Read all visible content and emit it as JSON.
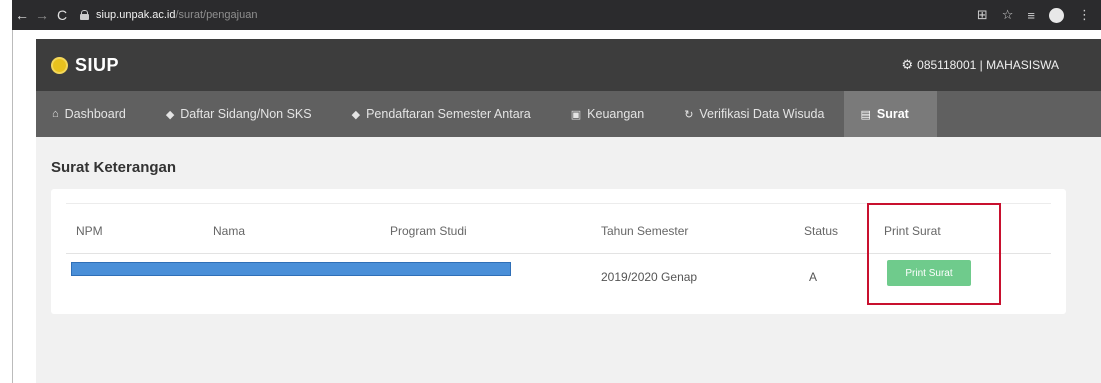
{
  "browser": {
    "url_host": "siup.unpak.ac.id",
    "url_path": "/surat/pengajuan",
    "icons": [
      "back-arrow-icon",
      "forward-arrow-icon",
      "reload-icon",
      "lock-icon",
      "translate-icon",
      "star-icon",
      "reading-list-icon",
      "profile-icon",
      "menu-icon"
    ]
  },
  "app": {
    "brand": "SIUP",
    "user": "085118001 | MAHASISWA",
    "colors": {
      "header": "#3d3d3d",
      "nav": "#606060",
      "nav_active": "#7a7a7a",
      "logo": "#e8c21e",
      "button": "#6fcb8c",
      "highlight": "#c8102e"
    }
  },
  "nav": {
    "items": [
      {
        "label": "Dashboard",
        "icon": "home-icon"
      },
      {
        "label": "Daftar Sidang/Non SKS",
        "icon": "graduation-cap-icon"
      },
      {
        "label": "Pendaftaran Semester Antara",
        "icon": "graduation-cap-icon"
      },
      {
        "label": "Keuangan",
        "icon": "money-icon"
      },
      {
        "label": "Verifikasi Data Wisuda",
        "icon": "refresh-icon"
      },
      {
        "label": "Surat",
        "icon": "document-icon",
        "active": true
      }
    ]
  },
  "page": {
    "title": "Surat Keterangan"
  },
  "table": {
    "headers": [
      "NPM",
      "Nama",
      "Program Studi",
      "Tahun Semester",
      "Status",
      "Print Surat"
    ],
    "rows": [
      {
        "npm": "",
        "nama": "",
        "program_studi": "",
        "tahun_semester": "2019/2020 Genap",
        "status": "A",
        "action_label": "Print Surat"
      }
    ]
  }
}
